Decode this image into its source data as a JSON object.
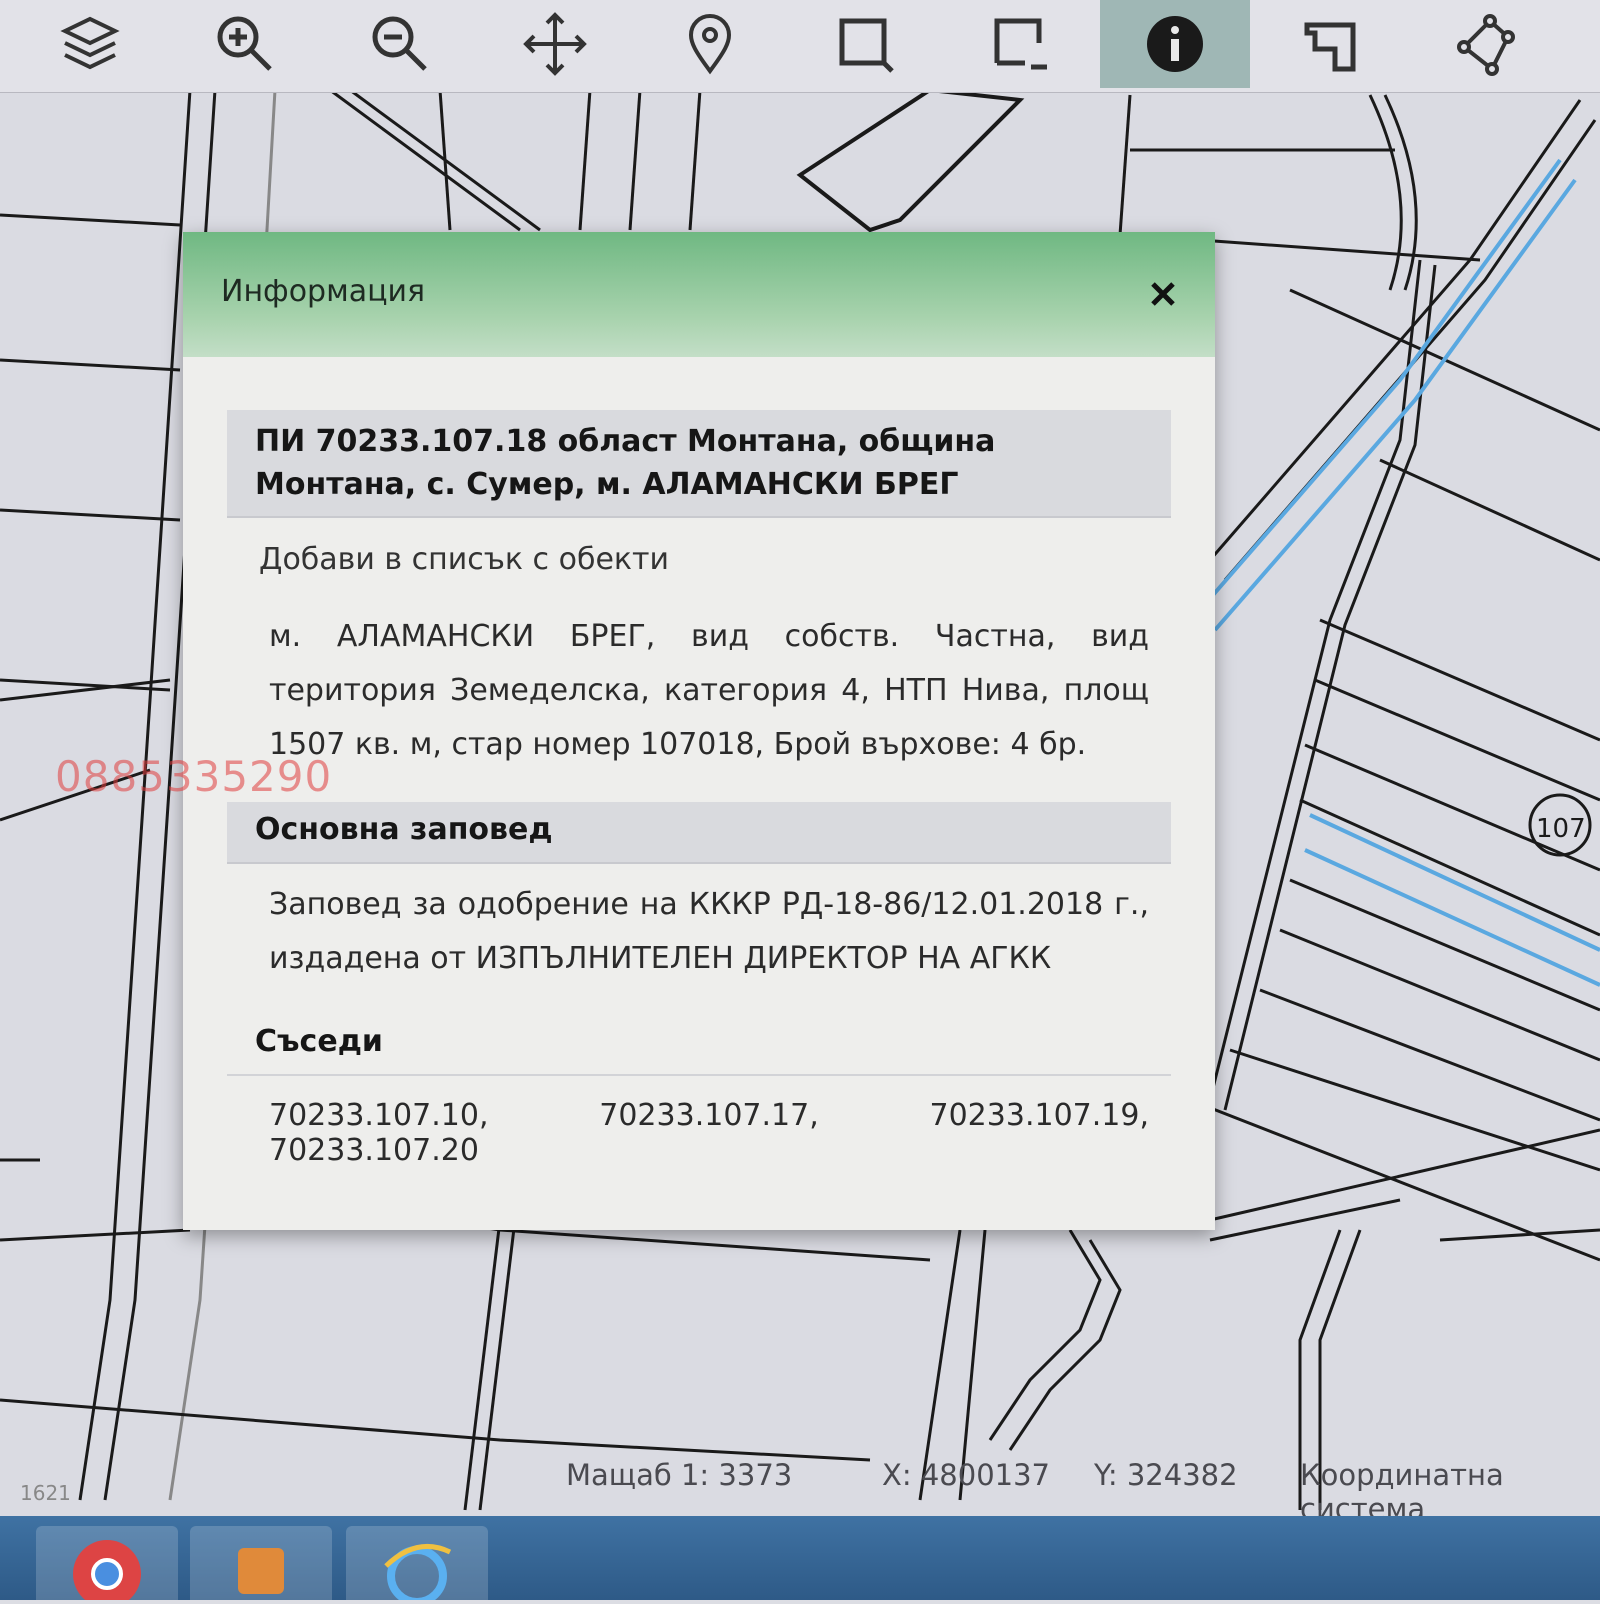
{
  "toolbar": {
    "tools": [
      "layers-icon",
      "zoom-in-icon",
      "zoom-out-icon",
      "pan-icon",
      "marker-icon",
      "select-rect-icon",
      "select-area-icon",
      "info-icon",
      "measure-icon",
      "polygon-icon"
    ],
    "active_tool": "info-icon"
  },
  "dialog": {
    "title": "Информация",
    "close_glyph": "✕",
    "parcel_title": "ПИ 70233.107.18 област Монтана, община Монтана, с. Сумер, м. АЛАМАНСКИ БРЕГ",
    "add_to_list": "Добави в списък с обекти",
    "details": "м. АЛАМАНСКИ БРЕГ, вид собств. Частна, вид територия Земеделска, категория 4, НТП Нива, площ 1507 кв. м, стар номер 107018, Брой върхове: 4 бр.",
    "order_heading": "Основна заповед",
    "order_text": "Заповед за одобрение на КККР РД-18-86/12.01.2018 г., издадена от ИЗПЪЛНИТЕЛЕН ДИРЕКТОР НА АГКК",
    "neighbors_heading": "Съседи",
    "neighbors": "70233.107.10, 70233.107.17, 70233.107.19, 70233.107.20"
  },
  "watermark": "0885335290",
  "map": {
    "block_label": "107",
    "corner_label": "1621"
  },
  "statusbar": {
    "scale": "Мащаб 1:  3373",
    "x": "X:  4800137",
    "y": "Y:  324382",
    "crs": "Координатна система"
  },
  "colors": {
    "header_green": "#7dbd8c",
    "active_tool_bg": "#9fb7b5",
    "highlight_blue": "#5aa8e0",
    "taskbar": "#3a6a9a"
  }
}
